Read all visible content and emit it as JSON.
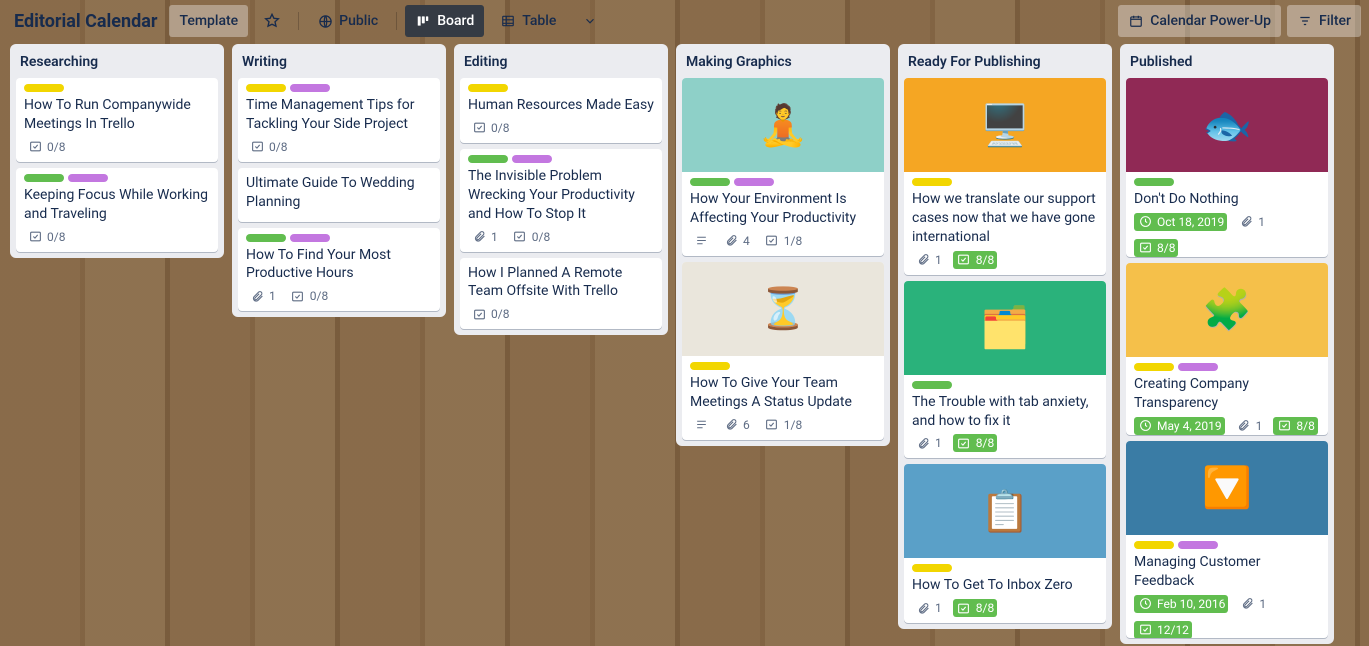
{
  "header": {
    "title": "Editorial Calendar",
    "template": "Template",
    "visibility": "Public",
    "board_view": "Board",
    "table_view": "Table",
    "powerup": "Calendar Power-Up",
    "filter": "Filter"
  },
  "lists": [
    {
      "name": "Researching",
      "cards": [
        {
          "labels": [
            "yellow"
          ],
          "title": "How To Run Companywide Meetings In Trello",
          "checklist": "0/8"
        },
        {
          "labels": [
            "green",
            "purple"
          ],
          "title": "Keeping Focus While Working and Traveling",
          "checklist": "0/8"
        }
      ]
    },
    {
      "name": "Writing",
      "cards": [
        {
          "labels": [
            "yellow",
            "purple"
          ],
          "title": "Time Management Tips for Tackling Your Side Project",
          "checklist": "0/8"
        },
        {
          "labels": [],
          "title": "Ultimate Guide To Wedding Planning"
        },
        {
          "labels": [
            "green",
            "purple"
          ],
          "title": "How To Find Your Most Productive Hours",
          "attach": "1",
          "checklist": "0/8"
        }
      ]
    },
    {
      "name": "Editing",
      "cards": [
        {
          "labels": [
            "yellow"
          ],
          "title": "Human Resources Made Easy",
          "checklist": "0/8"
        },
        {
          "labels": [
            "green",
            "purple"
          ],
          "title": "The Invisible Problem Wrecking Your Productivity and How To Stop It",
          "attach": "1",
          "checklist": "0/8"
        },
        {
          "labels": [],
          "title": "How I Planned A Remote Team Offsite With Trello",
          "checklist": "0/8"
        }
      ]
    },
    {
      "name": "Making Graphics",
      "cards": [
        {
          "cover": {
            "bg": "#8ed0c8",
            "emoji": "🧘"
          },
          "labels": [
            "green",
            "purple"
          ],
          "title": "How Your Environment Is Affecting Your Productivity",
          "desc": true,
          "attach": "4",
          "checklist": "1/8"
        },
        {
          "cover": {
            "bg": "#eae6dc",
            "emoji": "⏳"
          },
          "labels": [
            "yellow"
          ],
          "title": "How To Give Your Team Meetings A Status Update",
          "desc": true,
          "attach": "6",
          "checklist": "1/8"
        }
      ]
    },
    {
      "name": "Ready For Publishing",
      "cards": [
        {
          "cover": {
            "bg": "#f5a623",
            "emoji": "🖥️"
          },
          "labels": [
            "yellow"
          ],
          "title": "How we translate our support cases now that we have gone international",
          "attach": "1",
          "checklist": "8/8",
          "complete": true
        },
        {
          "cover": {
            "bg": "#2ab27b",
            "emoji": "🗂️"
          },
          "labels": [
            "green"
          ],
          "title": "The Trouble with tab anxiety, and how to fix it",
          "attach": "1",
          "checklist": "8/8",
          "complete": true
        },
        {
          "cover": {
            "bg": "#5aa0c8",
            "emoji": "📋"
          },
          "labels": [
            "yellow"
          ],
          "title": "How To Get To Inbox Zero",
          "attach": "1",
          "checklist": "8/8",
          "complete": true
        }
      ]
    },
    {
      "name": "Published",
      "cards": [
        {
          "cover": {
            "bg": "#902955",
            "emoji": "🐟"
          },
          "labels": [
            "green"
          ],
          "title": "Don't Do Nothing",
          "date": "Oct 18, 2019",
          "dateDone": true,
          "attach": "1",
          "checklist": "8/8",
          "complete": true
        },
        {
          "cover": {
            "bg": "#f5c04a",
            "emoji": "🧩"
          },
          "labels": [
            "yellow",
            "purple"
          ],
          "title": "Creating Company Transparency",
          "date": "May 4, 2019",
          "dateDone": true,
          "attach": "1",
          "checklist": "8/8",
          "complete": true
        },
        {
          "cover": {
            "bg": "#3a7ca5",
            "emoji": "🔽"
          },
          "labels": [
            "yellow",
            "purple"
          ],
          "title": "Managing Customer Feedback",
          "date": "Feb 10, 2016",
          "dateDone": true,
          "attach": "1",
          "checklist": "12/12",
          "complete": true
        }
      ]
    }
  ]
}
